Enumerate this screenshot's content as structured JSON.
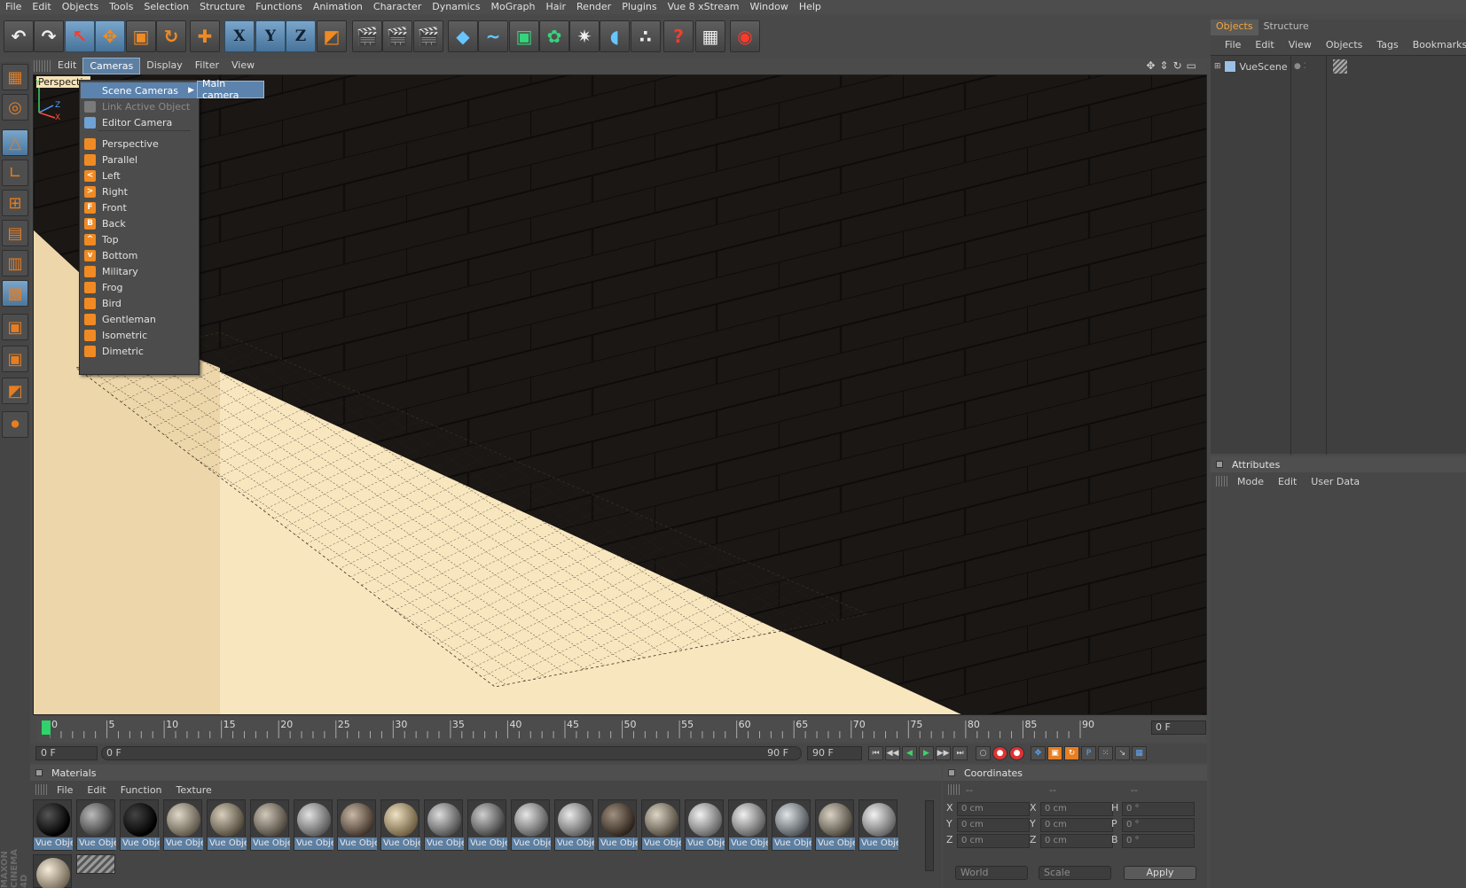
{
  "menubar": [
    "File",
    "Edit",
    "Objects",
    "Tools",
    "Selection",
    "Structure",
    "Functions",
    "Animation",
    "Character",
    "Dynamics",
    "MoGraph",
    "Hair",
    "Render",
    "Plugins",
    "Vue 8 xStream",
    "Window",
    "Help"
  ],
  "toolbar_icons": [
    "undo-icon",
    "redo-icon",
    "live-selection-icon",
    "move-icon",
    "scale-icon",
    "rotate-icon",
    "add-object-icon",
    "x-axis-lock-icon",
    "y-axis-lock-icon",
    "z-axis-lock-icon",
    "coordinate-system-icon",
    "render-view-icon",
    "render-picture-viewer-icon",
    "edit-render-settings-icon",
    "cube-primitive-icon",
    "spline-icon",
    "nurbs-icon",
    "array-icon",
    "deformer-icon",
    "environment-icon",
    "particle-icon",
    "help-cursor-icon",
    "render-settings-table-icon",
    "vue-render-icon"
  ],
  "toolbar_glyphs": [
    "↶",
    "↷",
    "↖",
    "✥",
    "▣",
    "↻",
    "✚",
    "X",
    "Y",
    "Z",
    "◩",
    "🎬",
    "🎬",
    "🎬",
    "◆",
    "~",
    "▣",
    "✿",
    "✷",
    "◖",
    "∴",
    "?",
    "▦",
    "◉"
  ],
  "viewport": {
    "menu": [
      "Edit",
      "Cameras",
      "Display",
      "Filter",
      "View"
    ],
    "active_menu": "Cameras",
    "label": "Perspectiv",
    "axes": {
      "y": "Y",
      "z": "Z",
      "x": "X"
    }
  },
  "camera_menu": {
    "items": [
      {
        "label": "Scene Cameras",
        "icon": "",
        "state": "highlight",
        "submenu": true
      },
      {
        "label": "Link Active Object",
        "icon": "",
        "state": "disabled"
      },
      {
        "label": "Editor Camera",
        "icon": "",
        "state": "normal"
      },
      {
        "label": "Perspective",
        "icon": "",
        "state": "normal"
      },
      {
        "label": "Parallel",
        "icon": "",
        "state": "normal"
      },
      {
        "label": "Left",
        "icon": "<",
        "state": "normal"
      },
      {
        "label": "Right",
        "icon": ">",
        "state": "normal"
      },
      {
        "label": "Front",
        "icon": "F",
        "state": "normal"
      },
      {
        "label": "Back",
        "icon": "B",
        "state": "normal"
      },
      {
        "label": "Top",
        "icon": "^",
        "state": "normal"
      },
      {
        "label": "Bottom",
        "icon": "v",
        "state": "normal"
      },
      {
        "label": "Military",
        "icon": "",
        "state": "normal"
      },
      {
        "label": "Frog",
        "icon": "",
        "state": "normal"
      },
      {
        "label": "Bird",
        "icon": "",
        "state": "normal"
      },
      {
        "label": "Gentleman",
        "icon": "",
        "state": "normal"
      },
      {
        "label": "Isometric",
        "icon": "",
        "state": "normal"
      },
      {
        "label": "Dimetric",
        "icon": "",
        "state": "normal"
      }
    ],
    "submenu_item": "Main camera"
  },
  "timeline": {
    "ticks": [
      "0",
      "5",
      "10",
      "15",
      "20",
      "25",
      "30",
      "35",
      "40",
      "45",
      "50",
      "55",
      "60",
      "65",
      "70",
      "75",
      "80",
      "85",
      "90"
    ],
    "current_frame_field": "0 F",
    "start_field": "0 F",
    "range_start": "0 F",
    "range_end": "90 F",
    "end_field": "90 F"
  },
  "materials": {
    "title": "Materials",
    "menu": [
      "File",
      "Edit",
      "Function",
      "Texture"
    ],
    "item_label": "Vue Obje",
    "count": 21
  },
  "coordinates": {
    "title": "Coordinates",
    "header_dashes": [
      "--",
      "--",
      "--"
    ],
    "rows": [
      {
        "a": "X",
        "av": "0 cm",
        "b": "X",
        "bv": "0 cm",
        "c": "H",
        "cv": "0 °"
      },
      {
        "a": "Y",
        "av": "0 cm",
        "b": "Y",
        "bv": "0 cm",
        "c": "P",
        "cv": "0 °"
      },
      {
        "a": "Z",
        "av": "0 cm",
        "b": "Z",
        "bv": "0 cm",
        "c": "B",
        "cv": "0 °"
      }
    ],
    "world": "World",
    "scale": "Scale",
    "apply": "Apply"
  },
  "objects_panel": {
    "tabs": [
      "Objects",
      "Structure"
    ],
    "menu": [
      "File",
      "Edit",
      "View",
      "Objects",
      "Tags",
      "Bookmarks"
    ],
    "object_name": "VueScene"
  },
  "attributes_panel": {
    "title": "Attributes",
    "menu": [
      "Mode",
      "Edit",
      "User Data"
    ]
  },
  "brand": "MAXON CINEMA 4D"
}
